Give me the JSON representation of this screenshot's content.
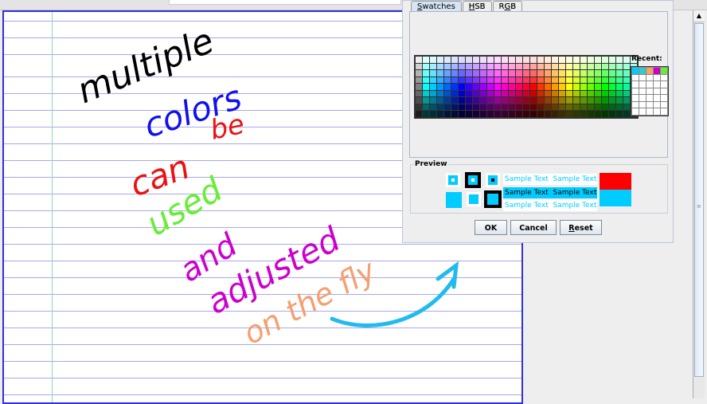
{
  "dialog": {
    "tabs": [
      {
        "label": "Swatches",
        "mnemonic": "S",
        "rest": "watches"
      },
      {
        "label": "HSB",
        "mnemonic": "H",
        "rest": "SB"
      },
      {
        "label": "RGB",
        "pre": "R",
        "mnemonic": "G",
        "rest": "B"
      }
    ],
    "active_tab": "Swatches",
    "recent_label": "Recent:",
    "recent_colors": [
      "#00ccff",
      "#33cccc",
      "#f4a460",
      "#cc00cc",
      "#66ee33"
    ],
    "preview_label": "Preview",
    "sample_text": "Sample Text",
    "preview_foreground": "#00ccff",
    "preview_background": "#ff0000",
    "buttons": {
      "ok": "OK",
      "cancel": "Cancel",
      "reset_mnemonic": "R",
      "reset_rest": "eset"
    }
  },
  "notebook": {
    "words": [
      {
        "text": "multiple",
        "color": "#000000"
      },
      {
        "text": "colors",
        "color": "#1010ee"
      },
      {
        "text": "be",
        "color": "#ee1111"
      },
      {
        "text": "can",
        "color": "#ee1111"
      },
      {
        "text": "used",
        "color": "#66ee33"
      },
      {
        "text": "and",
        "color": "#cc00cc"
      },
      {
        "text": "adjusted",
        "color": "#cc00cc"
      },
      {
        "text": "on the fly",
        "color": "#f4a070"
      }
    ],
    "arrow_color": "#22bbee"
  }
}
